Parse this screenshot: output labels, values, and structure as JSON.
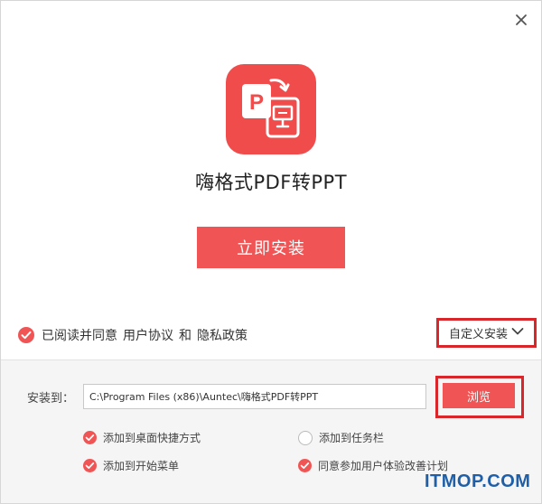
{
  "window": {
    "close_icon": "close-icon"
  },
  "app": {
    "icon": "pdf-to-ppt-app-icon",
    "title": "嗨格式PDF转PPT"
  },
  "actions": {
    "install_label": "立即安装",
    "custom_install_label": "自定义安装",
    "browse_label": "浏览"
  },
  "agreement": {
    "checked": true,
    "prefix": "已阅读并同意",
    "user_agreement": "用户协议",
    "and": "和",
    "privacy_policy": "隐私政策"
  },
  "install_path": {
    "label": "安装到：",
    "value": "C:\\Program Files (x86)\\Auntec\\嗨格式PDF转PPT"
  },
  "options": [
    {
      "label": "添加到桌面快捷方式",
      "checked": true
    },
    {
      "label": "添加到任务栏",
      "checked": false
    },
    {
      "label": "添加到开始菜单",
      "checked": true
    },
    {
      "label": "同意参加用户体验改善计划",
      "checked": true
    }
  ],
  "watermark": "ITMOP.COM",
  "colors": {
    "accent": "#f05454",
    "highlight_border": "#d9262b",
    "panel_bg": "#f5f5f5",
    "watermark": "#1f5fa8"
  }
}
